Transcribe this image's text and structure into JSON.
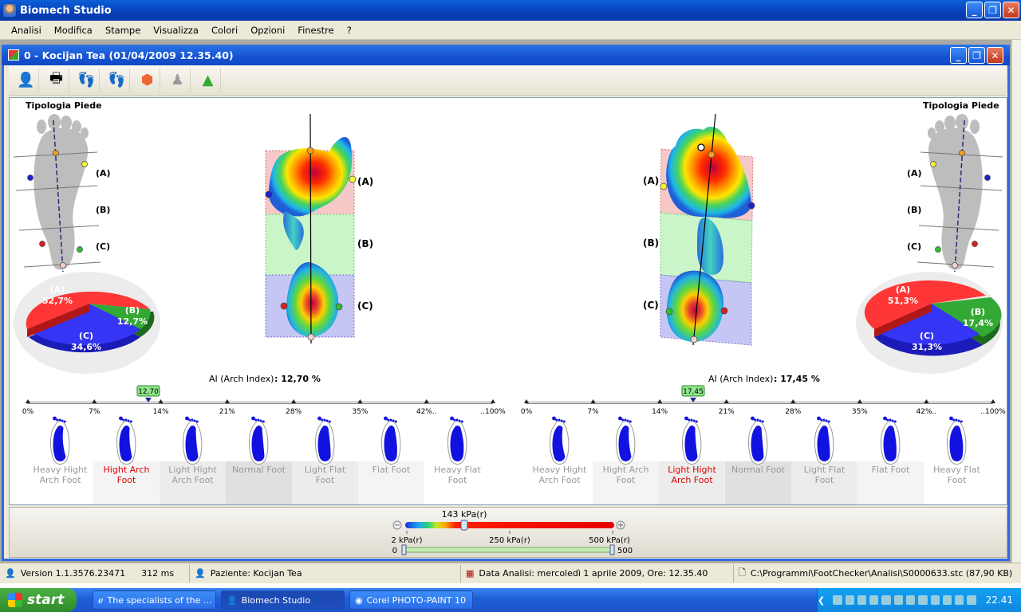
{
  "app": {
    "title": "Biomech Studio",
    "min": "_",
    "max": "❐",
    "close": "✕"
  },
  "menu": [
    "Analisi",
    "Modifica",
    "Stampe",
    "Visualizza",
    "Colori",
    "Opzioni",
    "Finestre",
    "?"
  ],
  "child": {
    "title": "0 -  Kocijan Tea  (01/04/2009 12.35.40)"
  },
  "left": {
    "tipologia": "Tipologia Piede",
    "labels": [
      "(A)",
      "(B)",
      "(C)"
    ],
    "pie": {
      "A": "(A)",
      "A_val": "52,7%",
      "B": "(B)",
      "B_val": "12,7%",
      "C": "(C)",
      "C_val": "34,6%"
    },
    "ai_label": "AI (Arch Index)",
    "ai_value": ": 12,70 %",
    "marker": "12,70",
    "ticks": [
      "0%",
      "7%",
      "14%",
      "21%",
      "28%",
      "35%",
      "42%..",
      "..100%"
    ],
    "types": [
      "Heavy Hight Arch Foot",
      "Hight Arch Foot",
      "Light Hight Arch Foot",
      "Normal Foot",
      "Light Flat Foot",
      "Flat Foot",
      "Heavy Flat Foot"
    ],
    "selected": 1
  },
  "right": {
    "tipologia": "Tipologia Piede",
    "labels": [
      "(A)",
      "(B)",
      "(C)"
    ],
    "pie": {
      "A": "(A)",
      "A_val": "51,3%",
      "B": "(B)",
      "B_val": "17,4%",
      "C": "(C)",
      "C_val": "31,3%"
    },
    "ai_label": "AI (Arch Index)",
    "ai_value": ": 17,45 %",
    "marker": "17,45",
    "ticks": [
      "0%",
      "7%",
      "14%",
      "21%",
      "28%",
      "35%",
      "42%..",
      "..100%"
    ],
    "types": [
      "Heavy Hight Arch Foot",
      "Hight Arch Foot",
      "Light Hight Arch Foot",
      "Normal Foot",
      "Light Flat Foot",
      "Flat Foot",
      "Heavy Flat Foot"
    ],
    "selected": 2
  },
  "scale": {
    "current": "143 kPa(r)",
    "min": "2 kPa(r)",
    "mid": "250 kPa(r)",
    "max": "500 kPa(r)",
    "range_min": "0",
    "range_max": "500",
    "minus": "−",
    "plus": "+"
  },
  "status": {
    "version": "Version 1.1.3576.23471",
    "ms": "312 ms",
    "patient": "Paziente: Kocijan  Tea",
    "date": "Data Analisi: mercoledì 1 aprile 2009, Ore: 12.35.40",
    "file": "C:\\Programmi\\FootChecker\\Analisi\\S0000633.stc  (87,90 KB)"
  },
  "taskbar": {
    "start": "start",
    "tasks": [
      "The specialists of the ...",
      "Biomech Studio",
      "Corel PHOTO-PAINT 10"
    ],
    "clock": "22.41"
  },
  "colors": {
    "A": "#f33c3c",
    "B": "#2e9a2e",
    "C": "#2b2bf0",
    "selected_text": "#e00000",
    "muted_text": "#999999"
  }
}
